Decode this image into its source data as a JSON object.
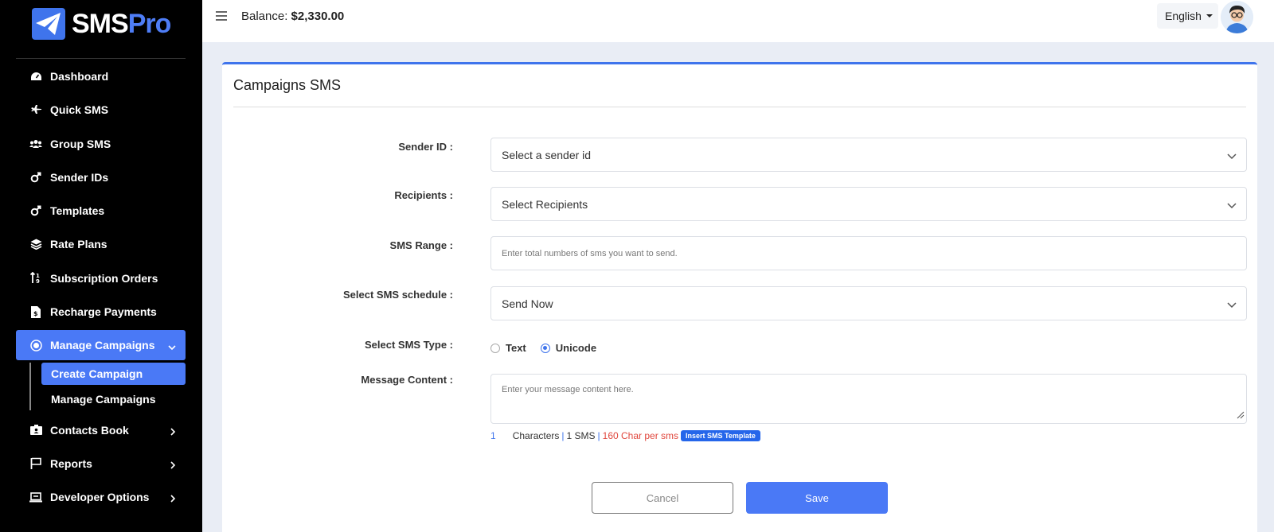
{
  "brand": {
    "name_part1": "SMS",
    "name_part2": "Pro"
  },
  "sidebar": {
    "items": [
      {
        "label": "Dashboard",
        "icon": "dashboard-icon"
      },
      {
        "label": "Quick SMS",
        "icon": "plane-icon"
      },
      {
        "label": "Group SMS",
        "icon": "users-icon"
      },
      {
        "label": "Sender IDs",
        "icon": "mars-icon"
      },
      {
        "label": "Templates",
        "icon": "mars-icon"
      },
      {
        "label": "Rate Plans",
        "icon": "layers-icon"
      },
      {
        "label": "Subscription Orders",
        "icon": "sort-icon"
      },
      {
        "label": "Recharge Payments",
        "icon": "invoice-icon"
      },
      {
        "label": "Manage Campaigns",
        "icon": "bullseye-icon"
      },
      {
        "label": "Contacts Book",
        "icon": "id-card-icon"
      },
      {
        "label": "Reports",
        "icon": "flag-icon"
      },
      {
        "label": "Developer Options",
        "icon": "laptop-icon"
      }
    ],
    "submenu": [
      {
        "label": "Create Campaign"
      },
      {
        "label": "Manage Campaigns"
      }
    ]
  },
  "topbar": {
    "balance_label": "Balance:",
    "balance_value": "$2,330.00",
    "language": "English"
  },
  "card": {
    "title": "Campaigns SMS",
    "sender_label": "Sender ID :",
    "sender_value": "Select a sender id",
    "recipients_label": "Recipients :",
    "recipients_value": "Select Recipients",
    "range_label": "SMS Range :",
    "range_placeholder": "Enter total numbers of sms you want to send.",
    "schedule_label": "Select SMS schedule :",
    "schedule_value": "Send Now",
    "type_label": "Select SMS Type :",
    "type_options": [
      "Text",
      "Unicode"
    ],
    "type_selected": "Unicode",
    "message_label": "Message Content :",
    "message_placeholder": "Enter your message content here.",
    "counter": {
      "count": "1",
      "characters": "Characters",
      "sep": "|",
      "sms": "1 SMS",
      "per_sms": "160 Char per sms",
      "template_badge": "Insert SMS Template"
    },
    "cancel_label": "Cancel",
    "save_label": "Save"
  },
  "colors": {
    "accent": "#4a79f6",
    "sidebar_bg": "#000000",
    "page_bg": "#e9edf5",
    "warn": "#e0463c"
  }
}
